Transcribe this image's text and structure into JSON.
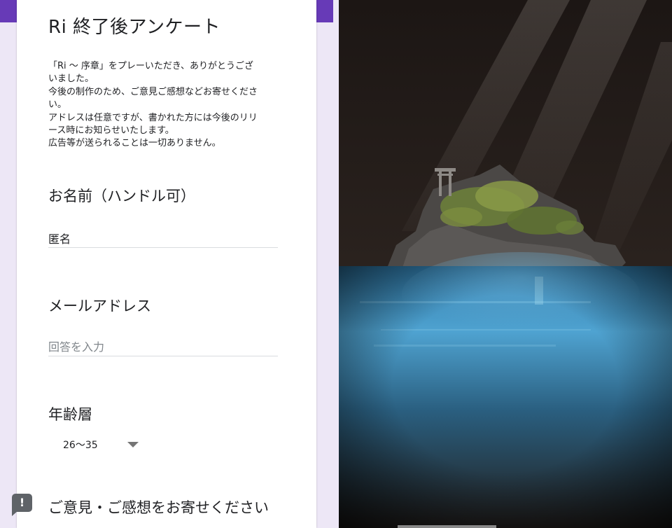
{
  "form": {
    "title": "Ri 終了後アンケート",
    "description_lines": [
      "「Ri ～ 序章」をプレーいただき、ありがとうござ",
      "いました。",
      "今後の制作のため、ご意見ご感想などお寄せくださ",
      "い。",
      "アドレスは任意ですが、書かれた方には今後のリリ",
      "ース時にお知らせいたします。",
      "広告等が送られることは一切ありません。"
    ],
    "questions": {
      "name": {
        "title": "お名前（ハンドル可）",
        "value": "匿名"
      },
      "email": {
        "title": "メールアドレス",
        "placeholder": "回答を入力"
      },
      "age": {
        "title": "年齢層",
        "selected": "26～35"
      },
      "feedback": {
        "title": "ご意見・ご感想をお寄せください"
      }
    },
    "report_icon": "exclamation-feedback-icon",
    "report_symbol": "!"
  },
  "colors": {
    "theme_purple": "#673ab7",
    "page_background": "#ede7f6",
    "water_blue": "#4fa3d1"
  }
}
